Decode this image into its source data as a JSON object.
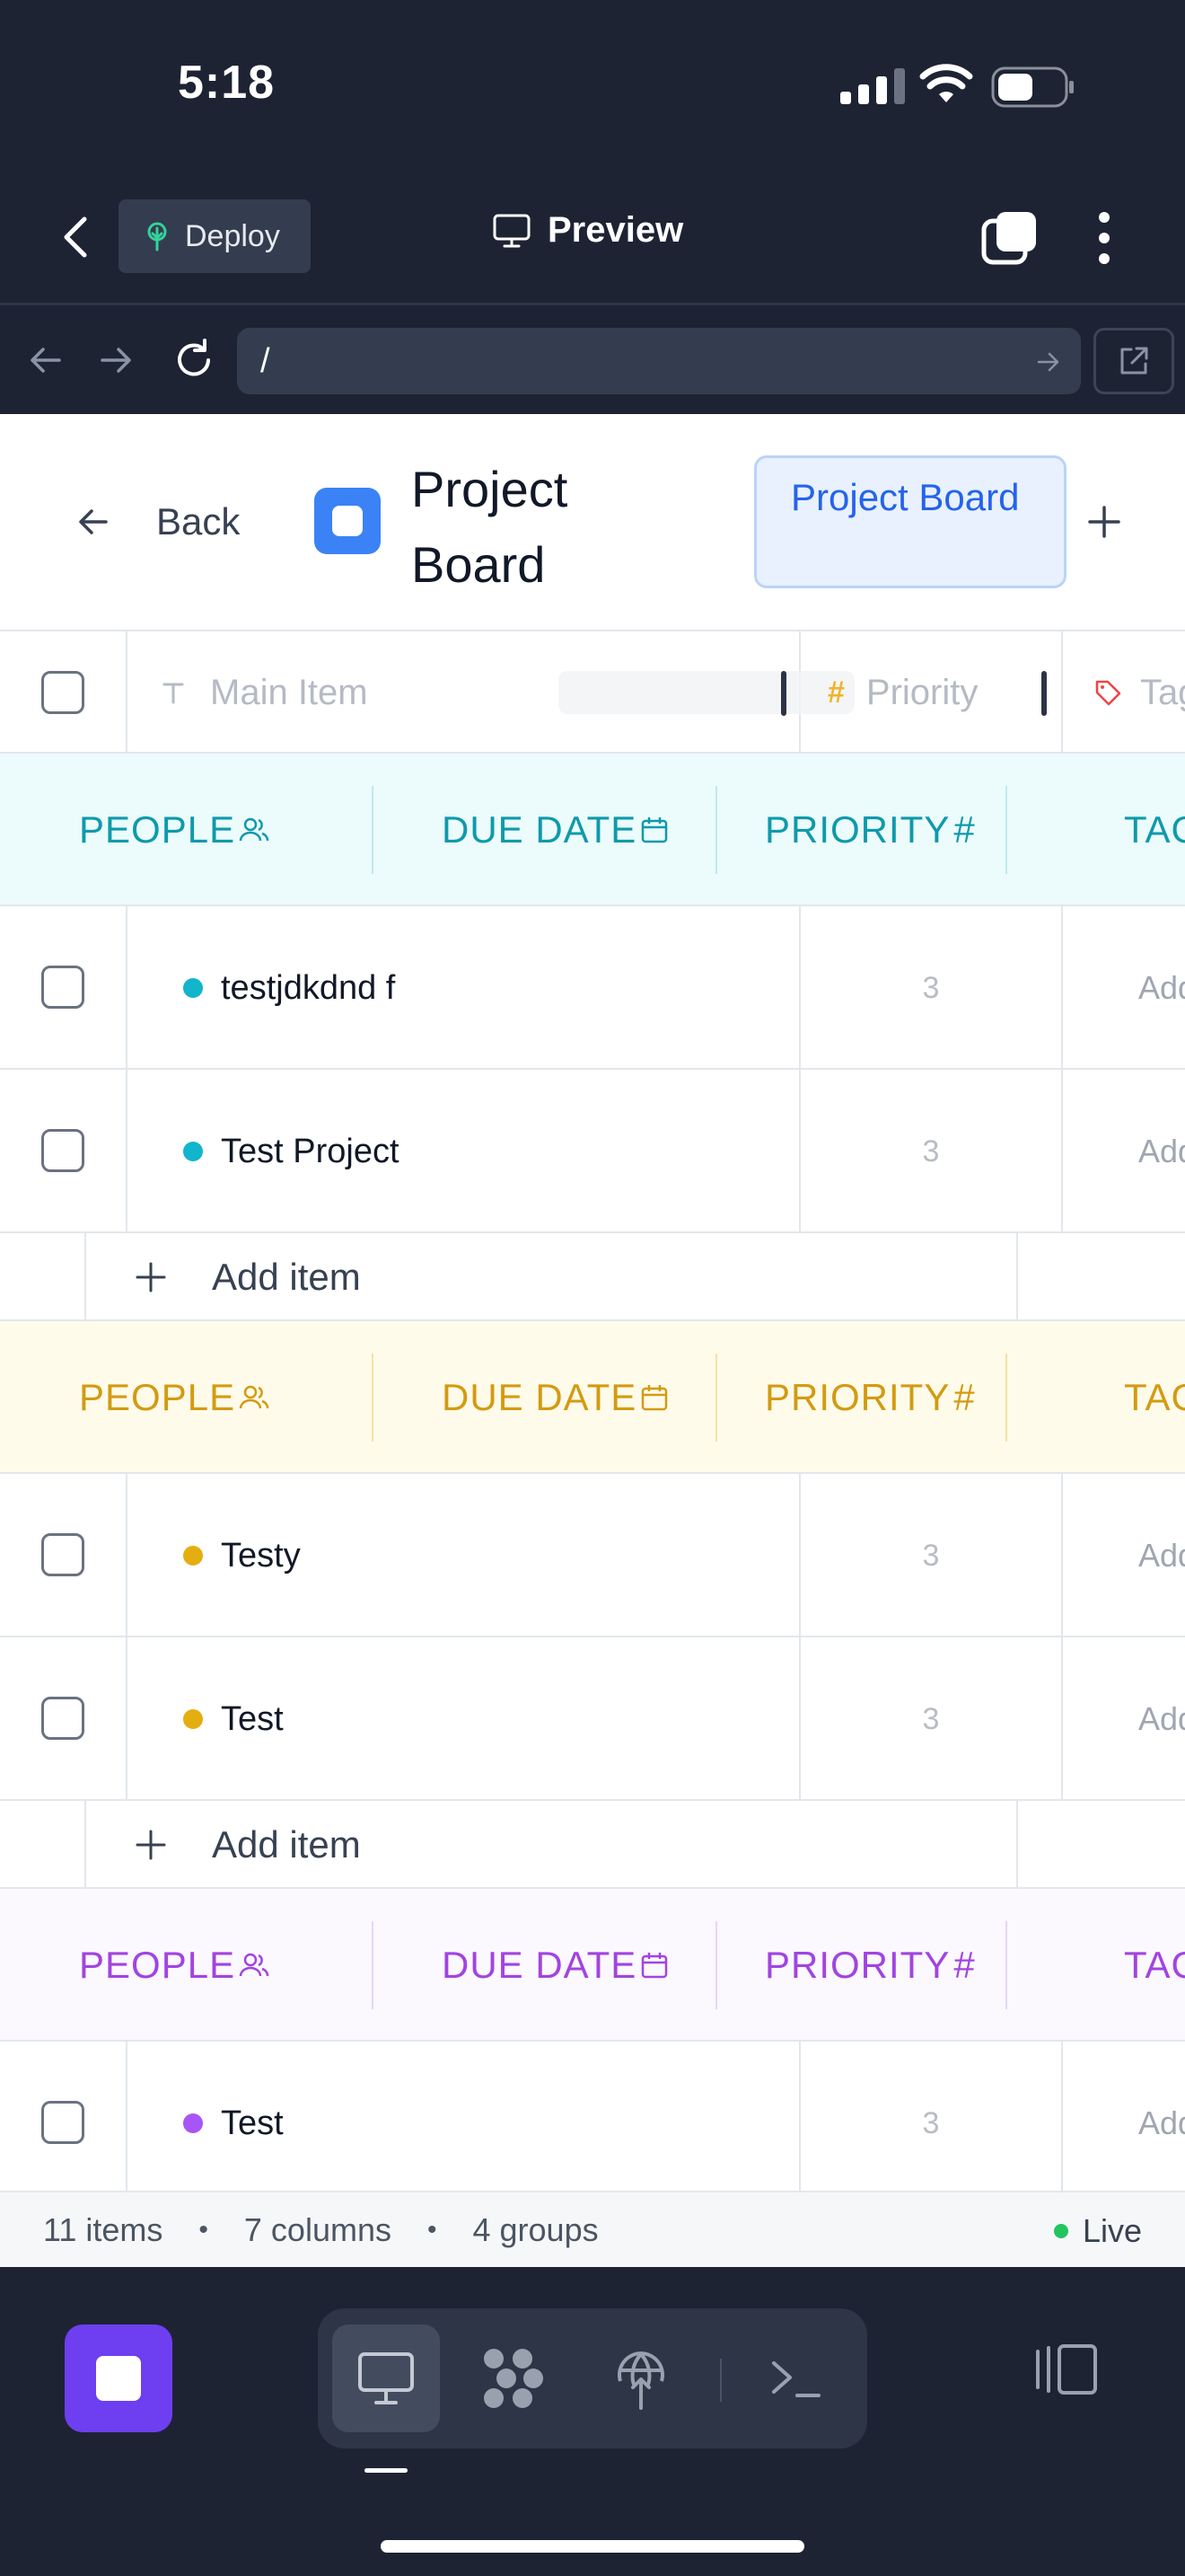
{
  "status_bar": {
    "time": "5:18"
  },
  "app_bar": {
    "deploy_label": "Deploy",
    "preview_label": "Preview"
  },
  "url_bar": {
    "url": "/"
  },
  "board": {
    "back_label": "Back",
    "title": "Project Board",
    "active_view_label": "Project Board",
    "add_view_icon": "plus-icon"
  },
  "columns": {
    "main_item": "Main Item",
    "priority": "Priority",
    "tags": "Tags"
  },
  "group_header_labels": {
    "people": "PEOPLE",
    "due_date": "DUE DATE",
    "priority": "PRIORITY",
    "tags": "TAGS"
  },
  "groups": [
    {
      "color": "#0e9aab",
      "header_bg": "#ecfbfc",
      "sep_color": "#bfe9ee",
      "items": [
        {
          "name": "testjdkdnd f",
          "priority": "3",
          "tags": "Add"
        },
        {
          "name": "Test Project",
          "priority": "3",
          "tags": "Add"
        }
      ],
      "add_label": "Add item"
    },
    {
      "color": "#d39b12",
      "header_bg": "#fffbea",
      "sep_color": "#f3e2a4",
      "items": [
        {
          "name": "Testy",
          "priority": "3",
          "tags": "Add"
        },
        {
          "name": "Test",
          "priority": "3",
          "tags": "Add"
        }
      ],
      "add_label": "Add item"
    },
    {
      "color": "#a244e0",
      "header_bg": "#fbf8fe",
      "sep_color": "#e6d7f5",
      "items": [
        {
          "name": "Test",
          "priority": "3",
          "tags": "Add"
        }
      ]
    }
  ],
  "footer": {
    "items": "11 items",
    "columns": "7 columns",
    "groups": "4 groups",
    "status": "Live",
    "bullet": "•"
  },
  "dot_colors": [
    "#12b5cb",
    "#e5ae10",
    "#a855f7"
  ]
}
